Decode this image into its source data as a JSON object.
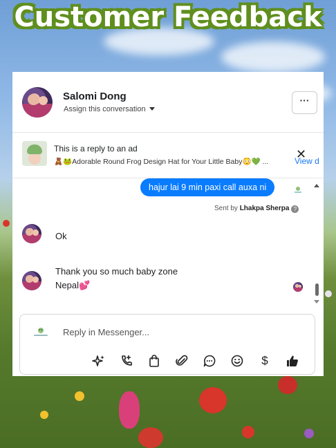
{
  "page_title": "Customer Feedback",
  "conversation": {
    "contact_name": "Salomi Dong",
    "assign_label": "Assign this conversation",
    "more_label": "···"
  },
  "ad_reply": {
    "title": "This is a reply to an ad",
    "description": "🧸🐸Adorable Round Frog Design Hat for Your Little Baby😳💚 ...",
    "view_label": "View d",
    "close_label": "✕"
  },
  "messages": [
    {
      "direction": "outgoing",
      "text": "hajur lai 9 min paxi call auxa ni"
    },
    {
      "direction": "incoming",
      "text": "Ok"
    },
    {
      "direction": "incoming",
      "text_line1": "Thank you so much baby zone",
      "text_line2": "Nepal💕"
    }
  ],
  "sent_by": {
    "prefix": "Sent by ",
    "name": "Lhakpa Sherpa",
    "help": "?"
  },
  "composer": {
    "placeholder": "Reply in Messenger...",
    "tools": [
      "sparkle-icon",
      "call-icon",
      "shopping-bag-icon",
      "attachment-icon",
      "chat-bubble-icon",
      "emoji-icon",
      "dollar-icon",
      "thumbs-up-icon"
    ],
    "dollar_glyph": "$"
  },
  "colors": {
    "title_outline": "#5f8f1e",
    "messenger_blue": "#0a7cff",
    "link_blue": "#1877f2",
    "panel_bg": "#ffffff"
  }
}
